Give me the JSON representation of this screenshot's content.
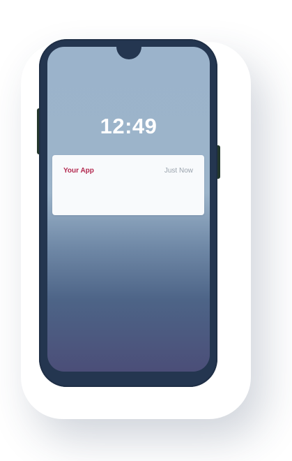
{
  "lockscreen": {
    "time": "12:49"
  },
  "notification": {
    "app_name": "Your App",
    "timestamp": "Just Now",
    "app_name_color": "#b3294f"
  },
  "device": {
    "frame_color": "#243650",
    "screen_gradient": [
      "#9bb3cb",
      "#4d6487",
      "#4b4e78"
    ]
  }
}
